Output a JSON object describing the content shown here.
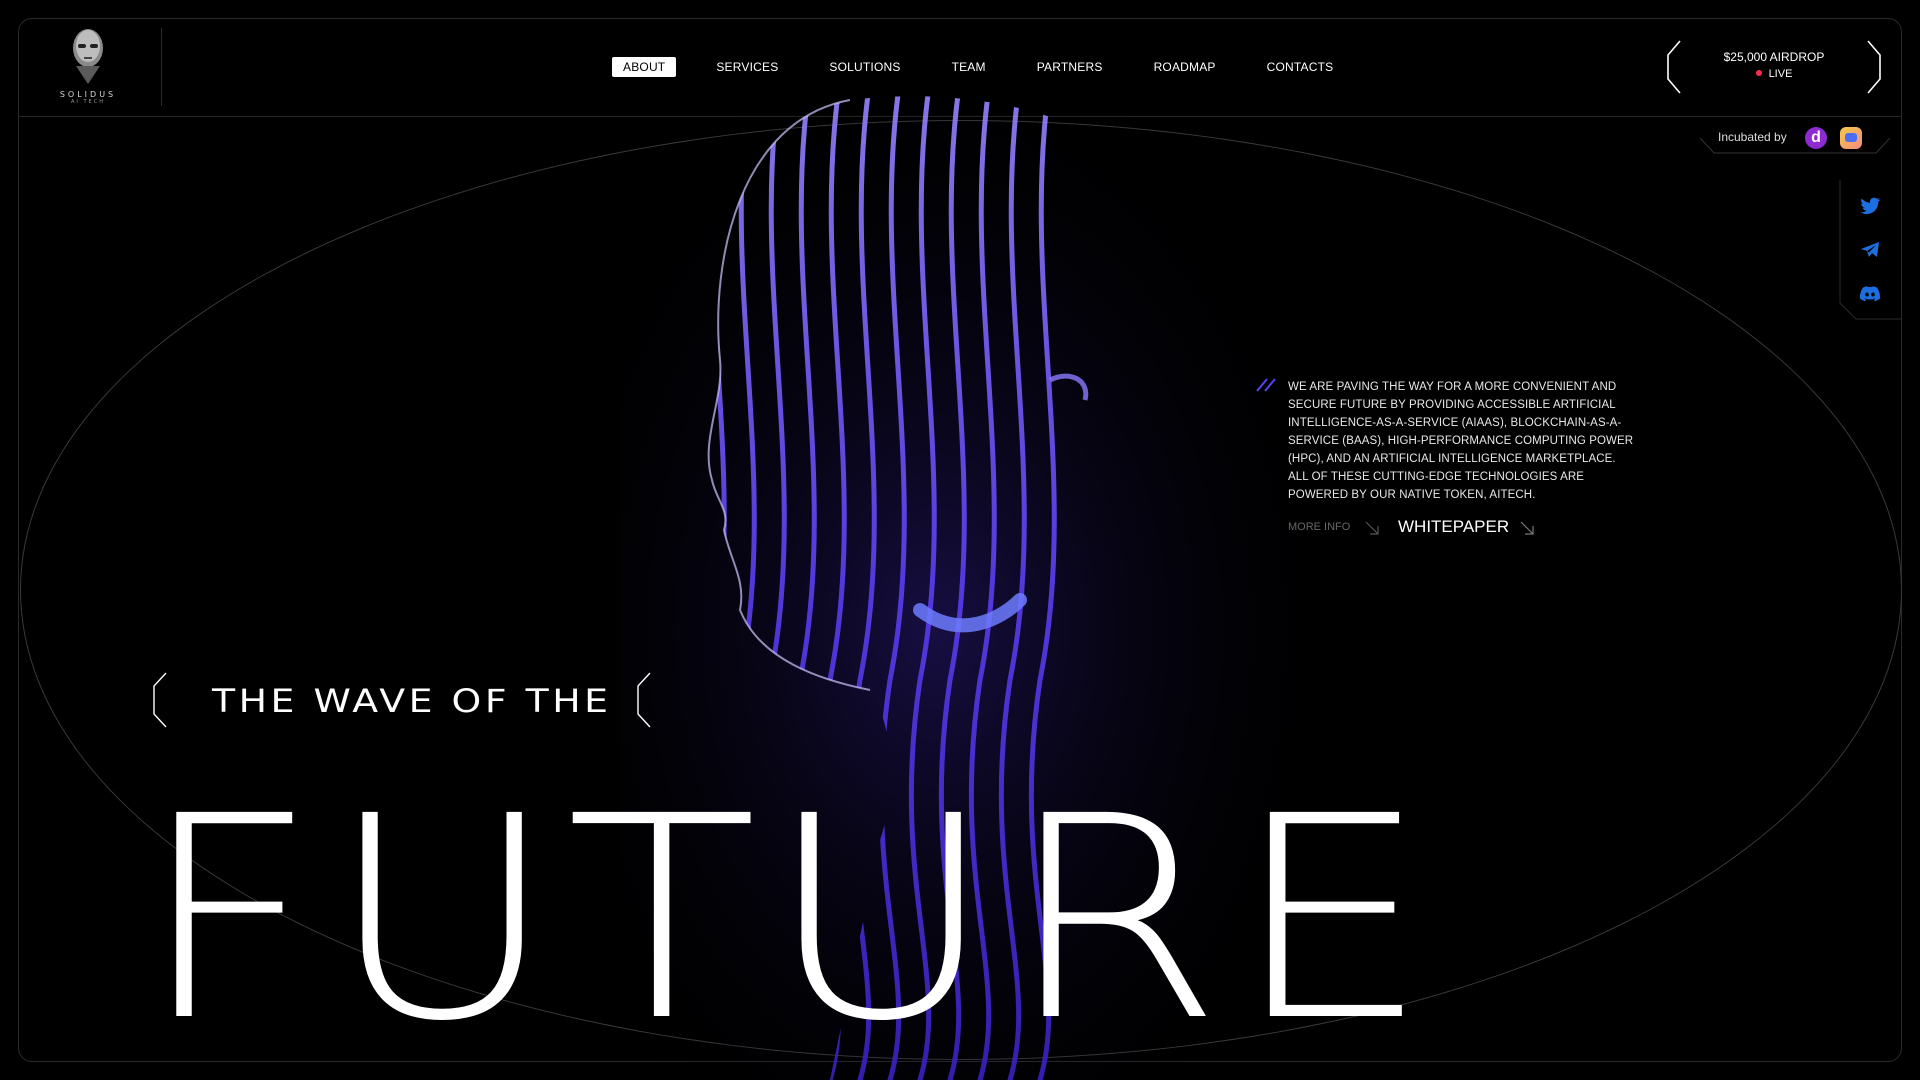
{
  "brand": {
    "name": "SOLIDUS",
    "sub": "AI TECH"
  },
  "nav": {
    "items": [
      {
        "label": "ABOUT",
        "active": true
      },
      {
        "label": "SERVICES"
      },
      {
        "label": "SOLUTIONS"
      },
      {
        "label": "TEAM"
      },
      {
        "label": "PARTNERS"
      },
      {
        "label": "ROADMAP"
      },
      {
        "label": "CONTACTS"
      }
    ]
  },
  "airdrop": {
    "title": "$25,000 AIRDROP",
    "status": "LIVE",
    "status_color": "#ff2d4a"
  },
  "incubated": {
    "label": "Incubated by",
    "logos": [
      "d-logo-icon",
      "bot-logo-icon"
    ]
  },
  "social": {
    "icons": [
      "twitter-icon",
      "telegram-icon",
      "discord-icon"
    ],
    "color": "#1d6fe0"
  },
  "hero": {
    "description": "WE ARE PAVING THE WAY FOR A MORE CONVENIENT AND SECURE FUTURE BY PROVIDING ACCESSIBLE ARTIFICIAL INTELLIGENCE-AS-A-SERVICE (AIAAS), BLOCKCHAIN-AS-A-SERVICE (BAAS), HIGH-PERFORMANCE COMPUTING POWER (HPC), AND AN ARTIFICIAL INTELLIGENCE MARKETPLACE. ALL OF THESE CUTTING-EDGE TECHNOLOGIES ARE POWERED BY OUR NATIVE TOKEN, AITECH.",
    "more_info": "MORE INFO",
    "whitepaper": "WHITEPAPER",
    "tagline": "THE WAVE OF THE",
    "headline": "FUTURE"
  },
  "colors": {
    "background": "#000000",
    "accent_purple": "#5b3ff0",
    "accent_blue": "#3d5bff"
  }
}
